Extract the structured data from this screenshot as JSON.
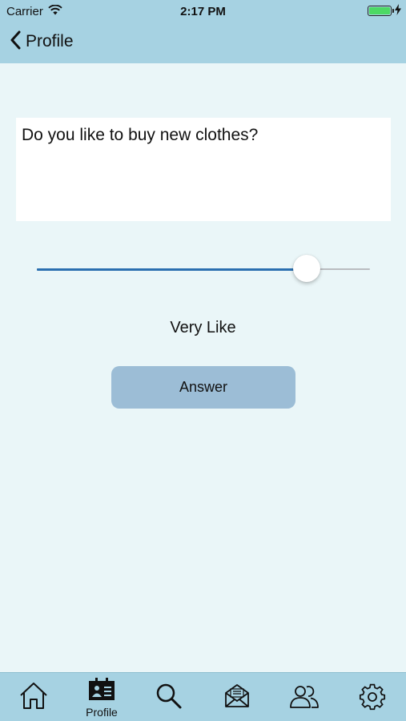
{
  "status_bar": {
    "carrier": "Carrier",
    "time": "2:17 PM",
    "battery_color": "#4cd964"
  },
  "nav": {
    "back_label": "Profile"
  },
  "question": {
    "text": "Do you like to buy new clothes?"
  },
  "slider": {
    "value": 0.81,
    "fill_color": "#2a6fb0"
  },
  "answer_value_label": "Very Like",
  "answer_button_label": "Answer",
  "tab_bar": {
    "tabs": [
      {
        "icon": "home-icon",
        "label": ""
      },
      {
        "icon": "profile-card-icon",
        "label": "Profile",
        "selected": true
      },
      {
        "icon": "search-icon",
        "label": ""
      },
      {
        "icon": "mail-icon",
        "label": ""
      },
      {
        "icon": "users-icon",
        "label": ""
      },
      {
        "icon": "gear-icon",
        "label": ""
      }
    ]
  },
  "colors": {
    "header_bg": "#a6d2e2",
    "page_bg": "#eaf6f8",
    "button_bg": "#9cbdd6"
  }
}
